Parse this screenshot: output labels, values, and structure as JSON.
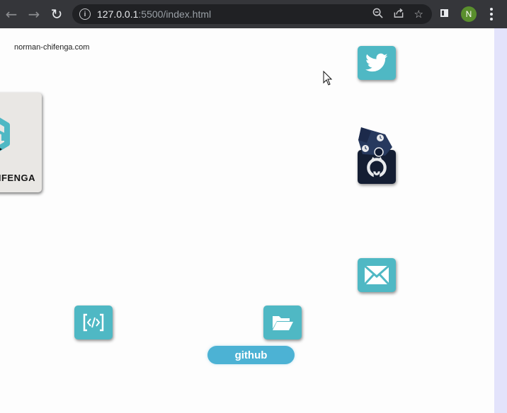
{
  "browser": {
    "url_host": "127.0.0.1",
    "url_rest": ":5500/index.html",
    "profile_initial": "N"
  },
  "page": {
    "site_name": "norman-chifenga.com",
    "logo_text": "IFENGA",
    "github_label": "github"
  },
  "icons": {
    "twitter": "twitter-bird-icon",
    "github": "github-octocat-icon",
    "email": "envelope-icon",
    "code": "code-icon",
    "folder": "folder-open-icon"
  },
  "colors": {
    "tile": "#4fb8c4",
    "tile_dark": "#141e33",
    "pill": "#4cb2d4",
    "chrome": "#35363a"
  }
}
